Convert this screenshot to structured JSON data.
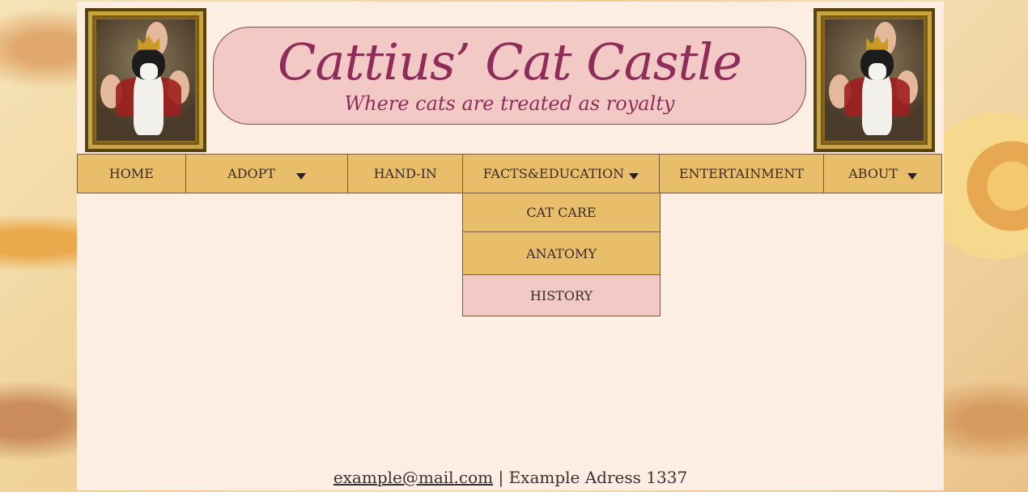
{
  "header": {
    "title": "Cattius’ Cat Castle",
    "subtitle": "Where cats are treated as royalty"
  },
  "nav": {
    "items": [
      {
        "label": "HOME",
        "has_dropdown": false
      },
      {
        "label": "ADOPT",
        "has_dropdown": true
      },
      {
        "label": "HAND-IN",
        "has_dropdown": false
      },
      {
        "label": "FACTS&EDUCATION",
        "has_dropdown": true
      },
      {
        "label": "ENTERTAINMENT",
        "has_dropdown": false
      },
      {
        "label": "ABOUT",
        "has_dropdown": true
      }
    ]
  },
  "dropdown": {
    "parent": "FACTS&EDUCATION",
    "items": [
      {
        "label": "CAT CARE"
      },
      {
        "label": "ANATOMY"
      },
      {
        "label": "HISTORY",
        "hovered": true
      }
    ]
  },
  "footer": {
    "email": "example@mail.com",
    "separator": "|",
    "address": "Example Adress 1337"
  },
  "colors": {
    "page_bg": "#fdeee3",
    "nav_bg": "#e8be6a",
    "title_box": "#f2c9c5",
    "title_text": "#8e2d59",
    "hover_bg": "#f2c9c5"
  }
}
